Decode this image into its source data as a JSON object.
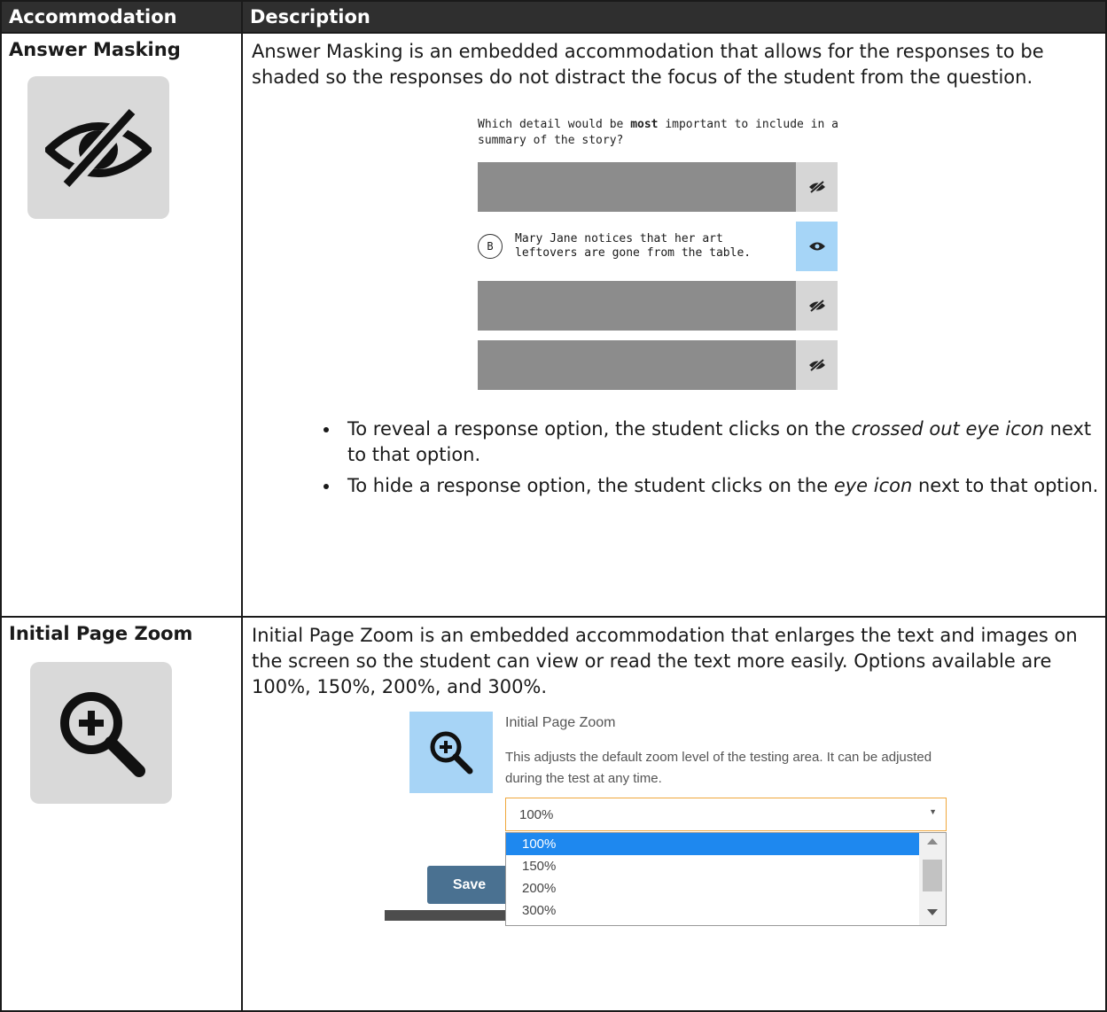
{
  "table": {
    "header": {
      "col1": "Accommodation",
      "col2": "Description"
    },
    "answer_masking": {
      "name": "Answer Masking",
      "icon": "eye-slash-icon",
      "description": "Answer Masking is an embedded accommodation that allows for the responses to be shaded so the responses do not distract the focus of the student from the question.",
      "demo": {
        "question_prefix": "Which detail would be ",
        "question_bold": "most",
        "question_suffix": " important to include in a summary of the story?",
        "option_letter": "B",
        "option_text": "Mary Jane notices that her art leftovers are gone from the table."
      },
      "bullets": [
        {
          "before": "To reveal a response option, the student clicks on the ",
          "em": "crossed out eye icon",
          "after": " next to that option."
        },
        {
          "before": "To hide a response option, the student clicks on the ",
          "em": "eye icon",
          "after": " next to that option."
        }
      ]
    },
    "page_zoom": {
      "name": "Initial Page Zoom",
      "icon": "zoom-in-icon",
      "description": "Initial Page Zoom is an embedded accommodation that enlarges the text and images on the screen so the student can view or read the text more easily. Options available are 100%, 150%, 200%, and 300%.",
      "demo": {
        "title": "Initial Page Zoom",
        "help": "This adjusts the default zoom level of the testing area. It can be adjusted during the test at any time.",
        "selected": "100%",
        "options": [
          "100%",
          "150%",
          "200%",
          "300%"
        ],
        "save_label": "Save"
      }
    }
  },
  "colors": {
    "header_bg": "#2f2f2f",
    "mask_gray": "#8c8c8c",
    "toggle_active": "#a6d5f7",
    "select_highlight": "#1e88ef",
    "save_button": "#4a7191"
  }
}
